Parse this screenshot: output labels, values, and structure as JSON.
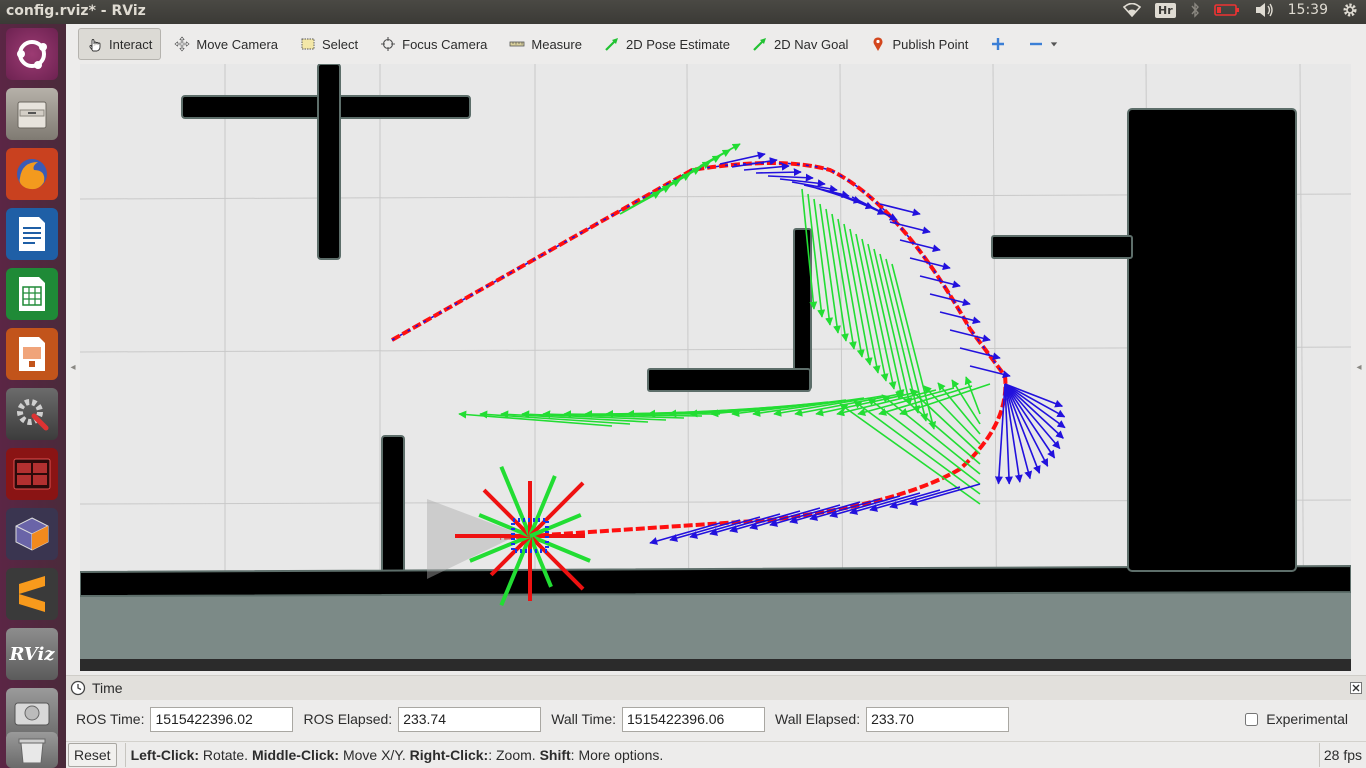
{
  "window": {
    "title": "config.rviz* - RViz"
  },
  "tray": {
    "keyboard": "Hr",
    "clock": "15:39"
  },
  "launcher": {
    "items": [
      {
        "icon": "ubuntu-dash-icon"
      },
      {
        "icon": "file-manager-icon"
      },
      {
        "icon": "firefox-icon"
      },
      {
        "icon": "writer-icon"
      },
      {
        "icon": "calc-icon"
      },
      {
        "icon": "impress-icon"
      },
      {
        "icon": "system-settings-icon"
      },
      {
        "icon": "terminal-icon"
      },
      {
        "icon": "virtualbox-icon"
      },
      {
        "icon": "sublime-text-icon"
      },
      {
        "icon": "rviz-icon",
        "label": "RViz"
      },
      {
        "icon": "disk-icon"
      },
      {
        "icon": "trash-icon"
      }
    ]
  },
  "toolbar": {
    "interact": "Interact",
    "move_camera": "Move Camera",
    "select": "Select",
    "focus_camera": "Focus Camera",
    "measure": "Measure",
    "pose_estimate": "2D Pose Estimate",
    "nav_goal": "2D Nav Goal",
    "publish_point": "Publish Point",
    "add": "+",
    "remove": "−"
  },
  "time_panel": {
    "title": "Time",
    "ros_time_label": "ROS Time:",
    "ros_time": "1515422396.02",
    "ros_elapsed_label": "ROS Elapsed:",
    "ros_elapsed": "233.74",
    "wall_time_label": "Wall Time:",
    "wall_time": "1515422396.06",
    "wall_elapsed_label": "Wall Elapsed:",
    "wall_elapsed": "233.70",
    "experimental_label": "Experimental"
  },
  "status": {
    "reset": "Reset",
    "left_click": "Left-Click:",
    "left_click_desc": " Rotate. ",
    "middle_click": "Middle-Click:",
    "middle_click_desc": " Move X/Y. ",
    "right_click": "Right-Click:",
    "right_click_desc": ": Zoom. ",
    "shift": "Shift",
    "shift_desc": ": More options.",
    "fps": "28 fps"
  },
  "colors": {
    "map_free": "#e8e8e8",
    "map_obstacle": "#000000",
    "map_unknown": "#7c8a87",
    "path_global": "#ff1010",
    "pose_array_green": "#22dd33",
    "pose_array_blue": "#2211dd",
    "footprint_blue": "#1133ee"
  }
}
